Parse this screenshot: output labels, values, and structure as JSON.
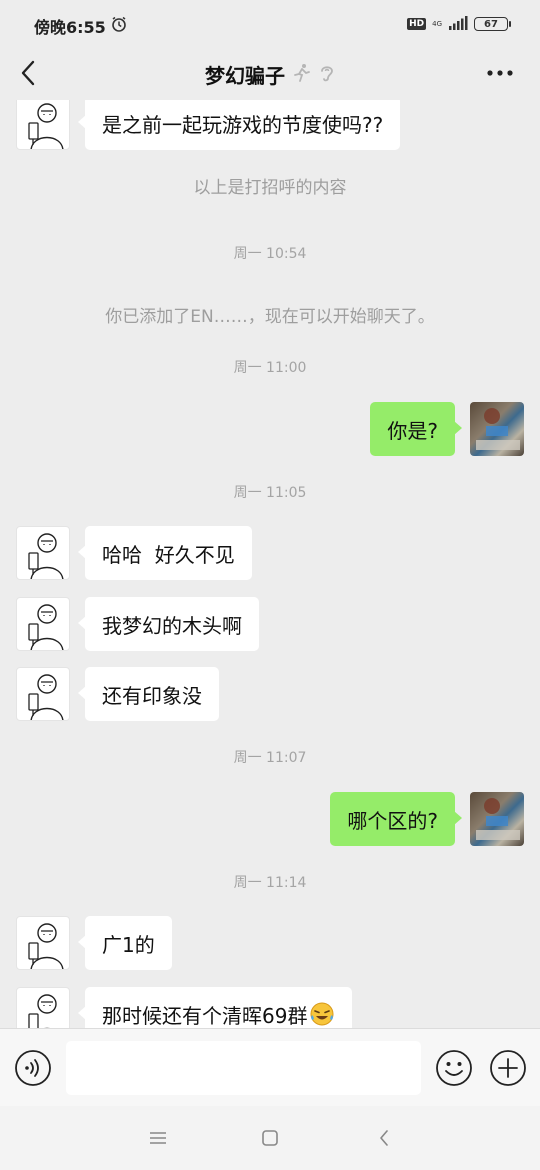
{
  "status_bar": {
    "time": "傍晚6:55",
    "hd_badge": "HD",
    "network": "4G",
    "battery": "67"
  },
  "header": {
    "title": "梦幻骗子",
    "back_icon": "chevron-left-icon",
    "more_icon": "more-dots-icon"
  },
  "messages": {
    "m1": "是之前一起玩游戏的节度使吗??",
    "sys1": "以上是打招呼的内容",
    "ts1": "周一 10:54",
    "sys2": "你已添加了EN……，现在可以开始聊天了。",
    "ts2": "周一 11:00",
    "m2": "你是?",
    "ts3": "周一 11:05",
    "m3": "哈哈  好久不见",
    "m4": "我梦幻的木头啊",
    "m5": "还有印象没",
    "ts4": "周一 11:07",
    "m6": "哪个区的?",
    "ts5": "周一 11:14",
    "m7": "广1的",
    "m8": "那时候还有个清晖69群"
  },
  "input_bar": {
    "placeholder": ""
  },
  "colors": {
    "background": "#ededed",
    "outgoing_bubble": "#95ec69",
    "incoming_bubble": "#ffffff",
    "system_text": "#9e9e9e"
  }
}
